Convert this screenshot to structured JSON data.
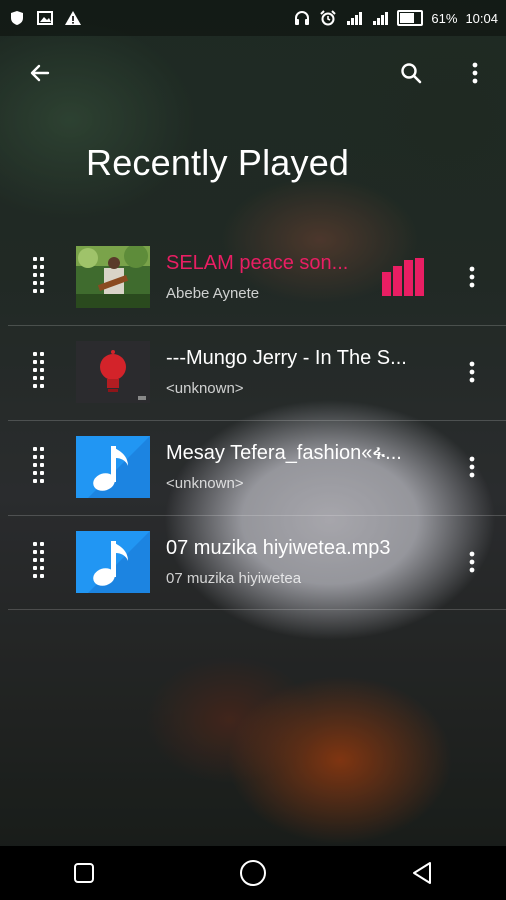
{
  "status_bar": {
    "battery": "61%",
    "time": "10:04",
    "battery_level": 0.61,
    "icons_left": [
      "shield-icon",
      "image-icon",
      "warning-icon"
    ],
    "icons_right": [
      "headphones-icon",
      "alarm-icon",
      "signal-icon",
      "signal-icon",
      "battery-icon"
    ]
  },
  "toolbar": {
    "back_icon": "arrow-left-icon",
    "search_icon": "search-icon",
    "menu_icon": "more-vert-icon"
  },
  "page": {
    "title": "Recently Played"
  },
  "colors": {
    "accent": "#e91e63",
    "note_blue": "#2196f3"
  },
  "tracks": [
    {
      "title": "SELAM peace son...",
      "subtitle": "Abebe Aynete",
      "art": "photo",
      "playing": true
    },
    {
      "title": "---Mungo Jerry - In The S...",
      "subtitle": "<unknown>",
      "art": "red-bulb",
      "playing": false
    },
    {
      "title": "Mesay Tefera_fashion«ፋ...",
      "subtitle": "<unknown>",
      "art": "music-note",
      "playing": false
    },
    {
      "title": "07 muzika hiyiwetea.mp3",
      "subtitle": "07 muzika hiyiwetea",
      "art": "music-note",
      "playing": false
    }
  ],
  "navbar": {
    "icons": [
      "recents-square-icon",
      "home-circle-icon",
      "back-triangle-icon"
    ]
  }
}
